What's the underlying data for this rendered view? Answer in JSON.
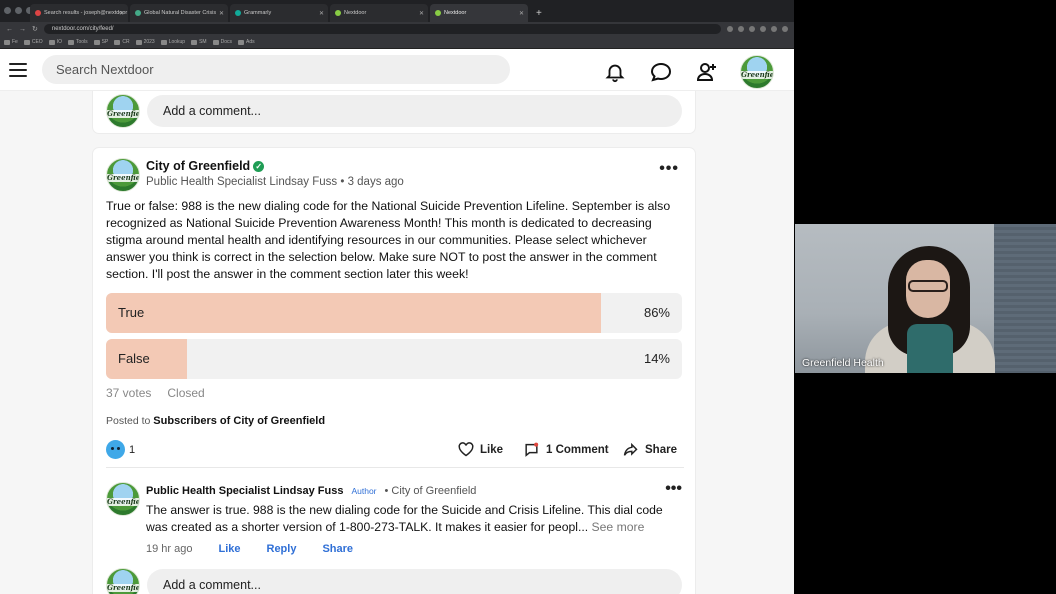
{
  "browser": {
    "tabs": [
      {
        "label": "Search results - joseph@nextdoor",
        "fav_color": "#d44"
      },
      {
        "label": "Global Natural Disaster Crisis",
        "fav_color": "#4a8"
      },
      {
        "label": "Grammarly",
        "fav_color": "#1a9"
      },
      {
        "label": "Nextdoor",
        "fav_color": "#8c4"
      },
      {
        "label": "Nextdoor",
        "fav_color": "#8c4"
      }
    ],
    "new_tab": "+",
    "url": "nextdoor.com/city/feed/",
    "bookmarks": [
      "Fe",
      "CEO",
      "IO",
      "Tools",
      "SP",
      "CR",
      "2023",
      "Lookup",
      "SM",
      "Docs",
      "Ads"
    ]
  },
  "header": {
    "search_placeholder": "Search Nextdoor",
    "icons": [
      "bell-icon",
      "chat-icon",
      "add-person-icon"
    ],
    "avatar_text": "Greenfield"
  },
  "top_card": {
    "comment_placeholder": "Add a comment..."
  },
  "post": {
    "author": "City of Greenfield",
    "subtitle": "Public Health Specialist Lindsay Fuss",
    "time": "3 days ago",
    "separator": "•",
    "more": "•••",
    "body": "True or false: 988 is the new dialing code for the National Suicide Prevention Lifeline. September is also recognized as National Suicide Prevention Awareness Month! This month is dedicated to decreasing stigma around mental health and identifying resources in our communities. Please select whichever answer you think is correct in the selection below. Make sure NOT to post the answer in the comment section. I'll post the answer in the comment section later this week!",
    "poll": {
      "options": [
        {
          "label": "True",
          "percent_text": "86%",
          "percent": 86
        },
        {
          "label": "False",
          "percent_text": "14%",
          "percent": 14
        }
      ],
      "votes": "37 votes",
      "status": "Closed"
    },
    "posted_to_prefix": "Posted to",
    "posted_to": "Subscribers of City of Greenfield",
    "reaction_count": "1",
    "actions": {
      "like": "Like",
      "comment": "1 Comment",
      "share": "Share"
    }
  },
  "reply": {
    "author": "Public Health Specialist Lindsay Fuss",
    "badge": "Author",
    "org": "• City of Greenfield",
    "more": "•••",
    "text": "The answer is true. 988 is the new dialing code for the Suicide and Crisis Lifeline. This dial code was created as a shorter version of 1-800-273-TALK. It makes it easier for peopl...",
    "see_more": "See more",
    "time": "19 hr ago",
    "like": "Like",
    "reply": "Reply",
    "share": "Share"
  },
  "bottom_comment_placeholder": "Add a comment...",
  "video": {
    "label": "Greenfield Health"
  },
  "colors": {
    "poll_fill": "#f3c9b5",
    "verified": "#1f9d55",
    "link": "#2f6fd6"
  }
}
